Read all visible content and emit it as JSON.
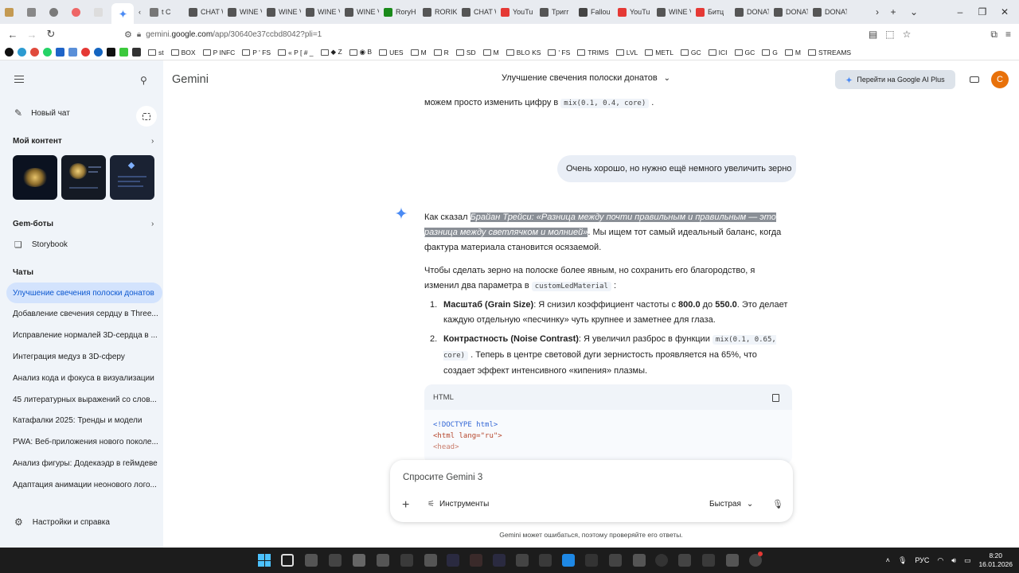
{
  "browser": {
    "tabs": [
      {
        "label": "t C",
        "color": "#777"
      },
      {
        "label": "CHAT WID",
        "color": "#555"
      },
      {
        "label": "WINE VEL",
        "color": "#555"
      },
      {
        "label": "WINE VEL",
        "color": "#555"
      },
      {
        "label": "WINE VEL",
        "color": "#555"
      },
      {
        "label": "WINE VEL",
        "color": "#555"
      },
      {
        "label": "RoryH",
        "color": "#1a8a1a"
      },
      {
        "label": "RORIK SM",
        "color": "#555"
      },
      {
        "label": "CHAT WID",
        "color": "#555"
      },
      {
        "label": "YouTu",
        "color": "#e53935"
      },
      {
        "label": "Тригг",
        "color": "#555"
      },
      {
        "label": "Fallou",
        "color": "#444"
      },
      {
        "label": "YouTu",
        "color": "#e53935"
      },
      {
        "label": "WINE VEL",
        "color": "#555"
      },
      {
        "label": "Битц",
        "color": "#e53935"
      },
      {
        "label": "DONATE V",
        "color": "#555"
      },
      {
        "label": "DONATE V",
        "color": "#555"
      },
      {
        "label": "DONATE V",
        "color": "#555"
      }
    ],
    "url_prefix": "gemini.",
    "url_domain": "google.com",
    "url_path": "/app/30640e37ccbd8042?pli=1",
    "bookmarks": [
      "st",
      "BOX",
      "P INFC",
      "P ' FS",
      "« P [ # _",
      "◆ Z",
      "◉ B",
      "UES",
      "M",
      "R",
      "SD",
      "M",
      "BLO KS",
      "' FS",
      "TRIMS",
      "LVL",
      "METL",
      "GC",
      "ICI",
      "GC",
      "G",
      "M",
      "STREAMS"
    ]
  },
  "sidebar": {
    "new_chat": "Новый чат",
    "my_content": "Мой контент",
    "gem_bots": "Gem-боты",
    "storybook": "Storybook",
    "chats_header": "Чаты",
    "chats": [
      "Улучшение свечения полоски донатов",
      "Добавление свечения сердцу в Three...",
      "Исправление нормалей 3D-сердца в ...",
      "Интеграция медуз в 3D-сферу",
      "Анализ кода и фокуса в визуализации",
      "45 литературных выражений со слов...",
      "Катафалки 2025: Тренды и модели",
      "PWA: Веб-приложения нового поколе...",
      "Анализ фигуры: Додекаэдр в геймдеве",
      "Адаптация анимации неонового лого..."
    ],
    "settings": "Настройки и справка"
  },
  "header": {
    "brand": "Gemini",
    "chat_title": "Улучшение свечения полоски донатов",
    "upgrade": "Перейти на Google AI Plus",
    "avatar_letter": "C"
  },
  "conversation": {
    "prev_text": "можем просто изменить цифру в",
    "prev_code": "mix(0.1, 0.4, core)",
    "user_message": "Очень хорошо, но нужно ещё немного увеличить зерно",
    "p1_lead": "Как сказал",
    "p1_quote": "Брайан Трейси: «Разница между почти правильным и правильным — это разница между светлячком и молнией»",
    "p1_rest": ". Мы ищем тот самый идеальный баланс, когда фактура материала становится осязаемой.",
    "p2_text": "Чтобы сделать зерно на полоске более явным, но сохранить его благородство, я изменил два параметра в",
    "p2_code": "customLedMaterial",
    "p2_colon": ":",
    "item1_title": "Масштаб (Grain Size)",
    "item1_a": ": Я снизил коэффициент частоты с",
    "item1_from": "800.0",
    "item1_b": "до",
    "item1_to": "550.0",
    "item1_c": ". Это делает каждую отдельную «песчинку» чуть крупнее и заметнее для глаза.",
    "item2_title": "Контрастность (Noise Contrast)",
    "item2_a": ": Я увеличил разброс в функции",
    "item2_code": "mix(0.1, 0.65, core)",
    "item2_b": ". Теперь в центре световой дуги зернистость проявляется на 65%, что создает эффект интенсивного «кипения» плазмы.",
    "code_lang": "HTML",
    "code_line1": "<!DOCTYPE html>",
    "code_line2": "<html lang=\"ru\">",
    "code_line3": "<head>"
  },
  "input": {
    "placeholder": "Спросите Gemini 3",
    "tools": "Инструменты",
    "mode": "Быстрая"
  },
  "disclaimer": "Gemini может ошибаться, поэтому проверяйте его ответы.",
  "taskbar": {
    "lang": "РУС",
    "time": "8:20",
    "date": "16.01.2026"
  },
  "colors": {
    "accent": "#0b57d0",
    "sidebar_bg": "#f0f4f9",
    "active_chat": "#d3e3fd",
    "avatar": "#e8710a"
  }
}
